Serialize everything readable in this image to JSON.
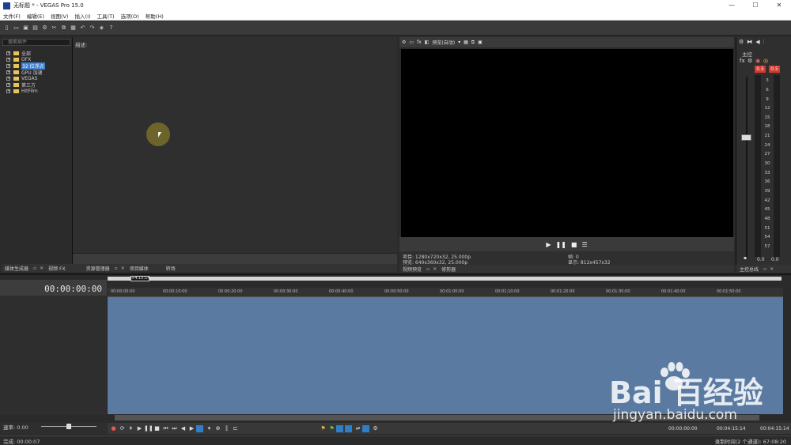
{
  "window": {
    "title": "无标题 * - VEGAS Pro 15.0",
    "minimize": "—",
    "maximize": "☐",
    "close": "✕"
  },
  "menu": [
    "文件(F)",
    "编辑(E)",
    "视图(V)",
    "插入(I)",
    "工具(T)",
    "选项(O)",
    "帮助(H)"
  ],
  "plugins": {
    "search_placeholder": "搜索插件",
    "items": [
      {
        "label": "全部"
      },
      {
        "label": "OFX"
      },
      {
        "label": "32 位浮点"
      },
      {
        "label": "GPU 加速"
      },
      {
        "label": "VEGAS"
      },
      {
        "label": "第三方"
      },
      {
        "label": "HitFilm"
      }
    ]
  },
  "description": {
    "label": "描述:"
  },
  "left_tabs": {
    "tab1": "媒体生成器",
    "tab2": "视频 FX",
    "tab3": "资源管理器",
    "tab4": "项目媒体",
    "tab5": "转场"
  },
  "preview": {
    "quality": "预览(自动)",
    "project_info": "项目: 1280x720x32, 25.000p",
    "preview_info": "预览: 640x360x32, 25.000p",
    "frame_info": "帧: 0",
    "display_info": "显示: 812x457x32",
    "tab_preview": "视频预览",
    "tab_trimmer": "修剪器"
  },
  "master": {
    "label": "主控",
    "peak_left": "0.5",
    "peak_right": "0.5",
    "db_scale": [
      "3",
      "6",
      "9",
      "12",
      "15",
      "18",
      "21",
      "24",
      "27",
      "30",
      "33",
      "36",
      "39",
      "42",
      "45",
      "48",
      "51",
      "54",
      "57"
    ],
    "bottom_left": "0.0",
    "bottom_right": "0.0",
    "tab": "主控总线"
  },
  "timeline": {
    "time": "00:00:00:00",
    "loop_label": "+4:15:14",
    "ruler": [
      "00:00:00:00",
      "00:00:10:00",
      "00:00:20:00",
      "00:00:30:00",
      "00:00:40:00",
      "00:00:50:00",
      "00:01:00:00",
      "00:01:10:00",
      "00:01:20:00",
      "00:01:30:00",
      "00:01:40:00",
      "00:01:50:00"
    ],
    "rate": "速率: 0.00",
    "transport_time1": "00:00:00:00",
    "transport_time2": "00:04:15:14",
    "transport_time3": "00:04:15:14"
  },
  "status": {
    "left": "完成: 00:00:07",
    "right": "录制时间(2 个通道): 67:08:20"
  },
  "watermark": {
    "brand": "Bai  百经验",
    "url": "jingyan.baidu.com"
  },
  "colors": {
    "track_area": "#5a7aa2",
    "accent": "#3d7fd0",
    "peak": "#d63a2e"
  }
}
